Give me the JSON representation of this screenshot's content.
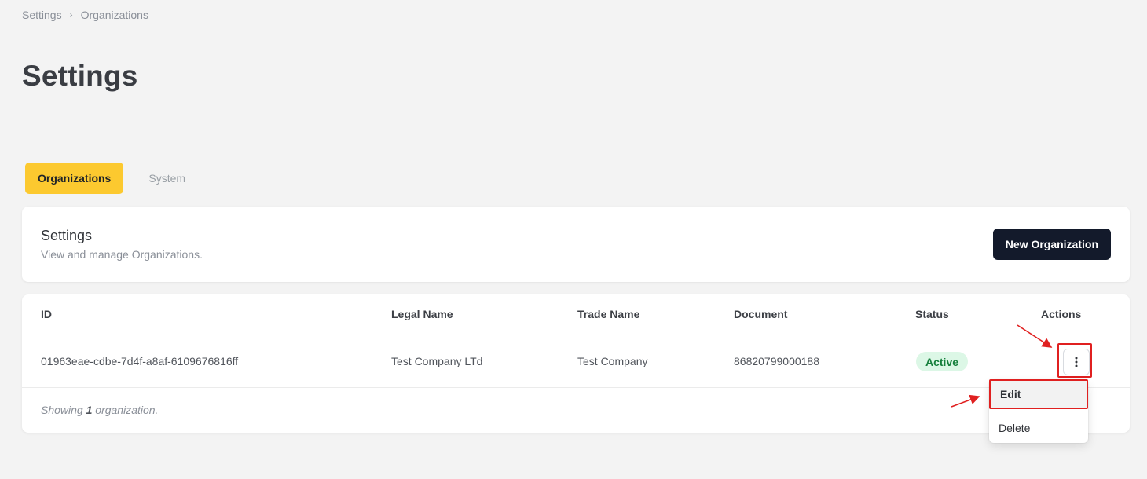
{
  "breadcrumb": {
    "items": [
      "Settings",
      "Organizations"
    ],
    "separator": "›"
  },
  "page": {
    "title": "Settings"
  },
  "tabs": [
    {
      "label": "Organizations",
      "active": true
    },
    {
      "label": "System",
      "active": false
    }
  ],
  "header_card": {
    "title": "Settings",
    "subtitle": "View and manage Organizations.",
    "new_button_label": "New Organization"
  },
  "table": {
    "columns": [
      "ID",
      "Legal Name",
      "Trade Name",
      "Document",
      "Status",
      "Actions"
    ],
    "rows": [
      {
        "id": "01963eae-cdbe-7d4f-a8af-6109676816ff",
        "legal_name": "Test Company LTd",
        "trade_name": "Test Company",
        "document": "86820799000188",
        "status": "Active"
      }
    ],
    "footer": {
      "prefix": "Showing",
      "count": "1",
      "suffix": "organization."
    }
  },
  "dropdown": {
    "items": [
      "Edit",
      "Delete"
    ]
  },
  "colors": {
    "accent": "#fcc92f",
    "primary_button": "#131a2b",
    "status_active_bg": "#dcf7e6",
    "status_active_text": "#17803d",
    "annotation": "#e02020"
  },
  "icons": {
    "row_actions": "more-vertical-icon"
  }
}
